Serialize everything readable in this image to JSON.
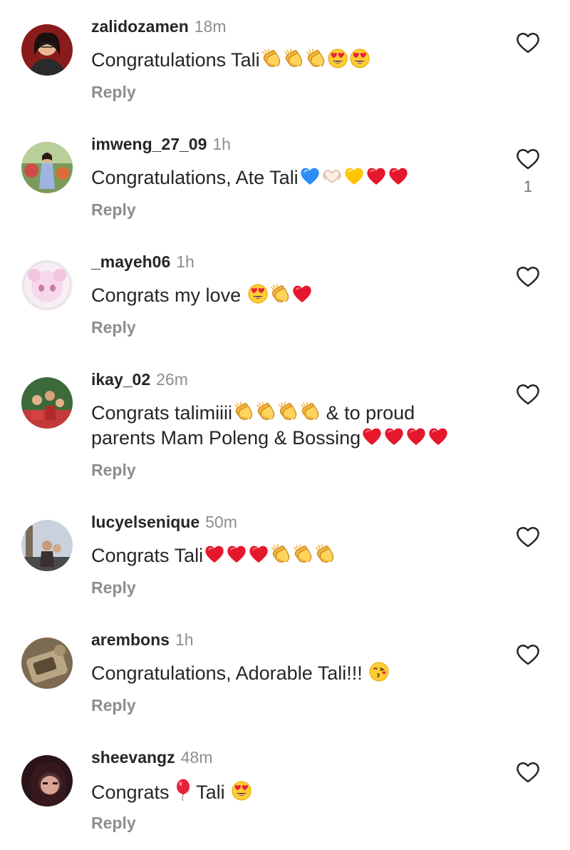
{
  "comments": [
    {
      "username": "zalidozamen",
      "time": "18m",
      "text": "Congratulations Tali",
      "emojis": [
        "clap",
        "clap",
        "clap",
        "heart-eyes",
        "heart-eyes"
      ],
      "reply_label": "Reply",
      "likes": ""
    },
    {
      "username": "imweng_27_09",
      "time": "1h",
      "text": "Congratulations, Ate Tali",
      "emojis": [
        "blue-heart",
        "heart-hands",
        "yellow-heart",
        "red-heart",
        "red-heart"
      ],
      "reply_label": "Reply",
      "likes": "1"
    },
    {
      "username": "_mayeh06",
      "time": "1h",
      "text": "Congrats my love ",
      "emojis": [
        "heart-eyes",
        "clap",
        "red-heart"
      ],
      "reply_label": "Reply",
      "likes": ""
    },
    {
      "username": "ikay_02",
      "time": "26m",
      "text_line1": "Congrats talimiiii",
      "text_line1_emojis": [
        "clap",
        "clap",
        "clap",
        "clap"
      ],
      "text_line1_tail": " & to proud",
      "text_line2": "parents Mam Poleng & Bossing",
      "text_line2_emojis": [
        "red-heart",
        "red-heart",
        "red-heart",
        "red-heart"
      ],
      "reply_label": "Reply",
      "likes": ""
    },
    {
      "username": "lucyelsenique",
      "time": "50m",
      "text": "Congrats Tali",
      "emojis": [
        "red-heart",
        "red-heart",
        "red-heart",
        "clap",
        "clap",
        "clap"
      ],
      "reply_label": "Reply",
      "likes": ""
    },
    {
      "username": "arembons",
      "time": "1h",
      "text": "Congratulations, Adorable Tali!!! ",
      "emojis": [
        "kiss-face"
      ],
      "reply_label": "Reply",
      "likes": ""
    },
    {
      "username": "sheevangz",
      "time": "48m",
      "text_a": "Congrats ",
      "emoji_mid": "balloon",
      "text_b": " Tali ",
      "emojis": [
        "heart-eyes"
      ],
      "reply_label": "Reply",
      "likes": ""
    }
  ],
  "colors": {
    "username": "#262626",
    "secondary": "#8e8e8e",
    "heart_outline": "#262626",
    "background": "#ffffff"
  },
  "icons": {
    "like": "heart-outline-icon"
  }
}
